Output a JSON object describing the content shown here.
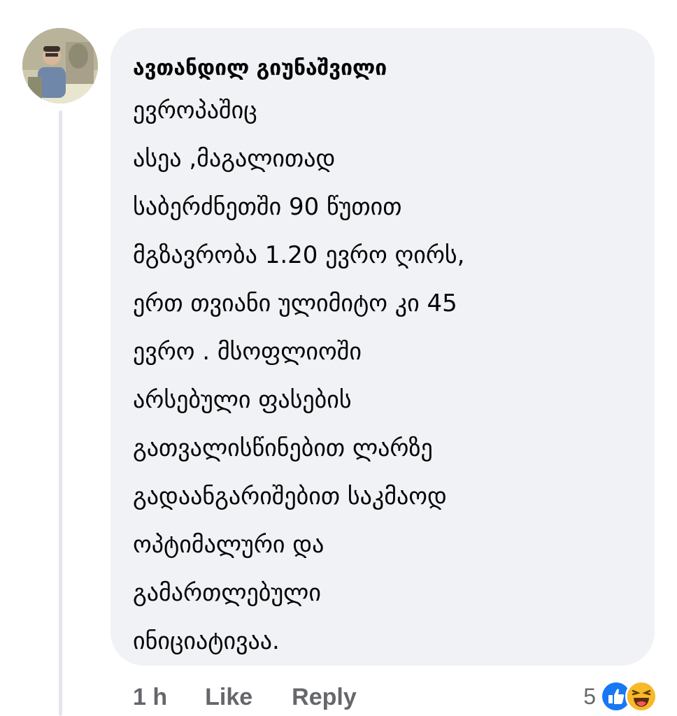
{
  "comment": {
    "author": "ავთანდილ გიუნაშვილი",
    "avatar_icon": "user-avatar-photo",
    "body_lines": [
      "ევროპაშიც",
      "ასეა ,მაგალითად",
      "საბერძნეთში 90 წუთით",
      "მგზავრობა 1.20 ევრო ღირს,",
      "ერთ თვიანი ულიმიტო კი 45",
      "ევრო . მსოფლიოში",
      "არსებული ფასების",
      "გათვალისწინებით ლარზე",
      "გადაანგარიშებით საკმაოდ",
      "ოპტიმალური და",
      "გამართლებული",
      "ინიციატივაა."
    ]
  },
  "actions": {
    "time": "1 h",
    "like_label": "Like",
    "reply_label": "Reply"
  },
  "reactions": {
    "count": "5",
    "icons": [
      "like-reaction-icon",
      "haha-reaction-icon"
    ],
    "like_color": "#1877f2",
    "haha_color": "#f7b928"
  }
}
